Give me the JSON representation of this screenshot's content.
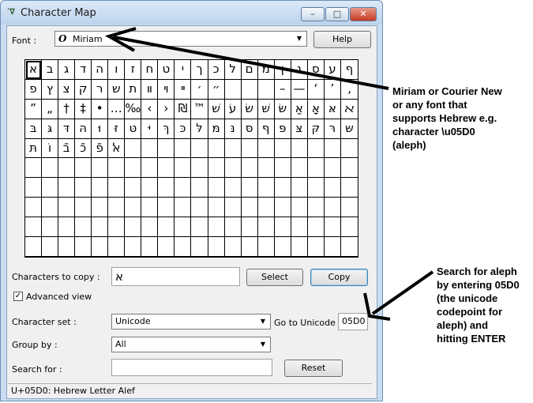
{
  "window": {
    "title": "Character Map",
    "controls": {
      "minimize": "–",
      "maximize": "□",
      "close": "✕"
    }
  },
  "font": {
    "label": "Font :",
    "font_icon": "O",
    "value": "Miriam",
    "help_label": "Help"
  },
  "grid": {
    "cells": [
      "א",
      "ב",
      "ג",
      "ד",
      "ה",
      "ו",
      "ז",
      "ח",
      "ט",
      "י",
      "ך",
      "כ",
      "ל",
      "ם",
      "מ",
      "ן",
      "נ",
      "ס",
      "ע",
      "ף",
      "פ",
      "ץ",
      "צ",
      "ק",
      "ר",
      "ש",
      "ת",
      "װ",
      "ױ",
      "ײ",
      "׳",
      "״",
      "",
      "",
      "",
      "–",
      "—",
      "‘",
      "’",
      "‚",
      "”",
      "„",
      "†",
      "‡",
      "•",
      "…",
      "‰",
      "‹",
      "›",
      "₪",
      "™",
      "שׁ",
      "עׂ",
      "שׂ",
      "שּׁ",
      "שּׂ",
      "אַ",
      "אָ",
      "אּ",
      "ﬡ",
      "בּ",
      "גּ",
      "דּ",
      "הּ",
      "וּ",
      "זּ",
      "טּ",
      "יּ",
      "ךּ",
      "כּ",
      "לּ",
      "מּ",
      "נּ",
      "סּ",
      "ףּ",
      "פּ",
      "צּ",
      "קּ",
      "רּ",
      "שּ",
      "תּ",
      "וֹ",
      "בֿ",
      "כֿ",
      "פֿ",
      "ﭏ",
      "",
      "",
      "",
      "",
      "",
      "",
      "",
      "",
      "",
      "",
      "",
      "",
      "",
      "",
      "",
      "",
      "",
      "",
      "",
      "",
      "",
      "",
      "",
      "",
      "",
      "",
      "",
      "",
      "",
      "",
      "",
      "",
      "",
      "",
      "",
      "",
      "",
      "",
      "",
      "",
      "",
      "",
      "",
      "",
      "",
      "",
      "",
      "",
      "",
      "",
      "",
      "",
      "",
      "",
      "",
      "",
      "",
      "",
      "",
      "",
      "",
      "",
      "",
      "",
      "",
      "",
      "",
      "",
      "",
      "",
      "",
      "",
      "",
      "",
      "",
      "",
      "",
      "",
      "",
      "",
      "",
      "",
      "",
      "",
      "",
      "",
      "",
      "",
      "",
      "",
      "",
      "",
      "",
      "",
      "",
      "",
      "",
      "",
      "",
      "",
      "",
      "",
      "",
      "",
      "",
      "",
      "",
      "",
      "",
      "",
      "",
      "",
      "",
      ""
    ]
  },
  "copy": {
    "label": "Characters to copy :",
    "value": "א",
    "select_label": "Select",
    "copy_label": "Copy"
  },
  "advanced": {
    "label": "Advanced view",
    "checked": "✓"
  },
  "charset": {
    "label": "Character set :",
    "value": "Unicode",
    "goto_label": "Go to Unicode :",
    "goto_value": "05D0"
  },
  "groupby": {
    "label": "Group by :",
    "value": "All"
  },
  "search": {
    "label": "Search for :",
    "value": "",
    "reset_label": "Reset"
  },
  "status": {
    "text": "U+05D0: Hebrew Letter Alef"
  },
  "annotations": {
    "note1": [
      "Miriam or Courier New",
      "or any font that",
      "supports Hebrew e.g.",
      "character \\u05D0",
      "(aleph)"
    ],
    "note2": [
      "Search for aleph",
      "by entering 05D0",
      "(the unicode",
      "codepoint for",
      "aleph) and",
      "hitting ENTER"
    ]
  }
}
